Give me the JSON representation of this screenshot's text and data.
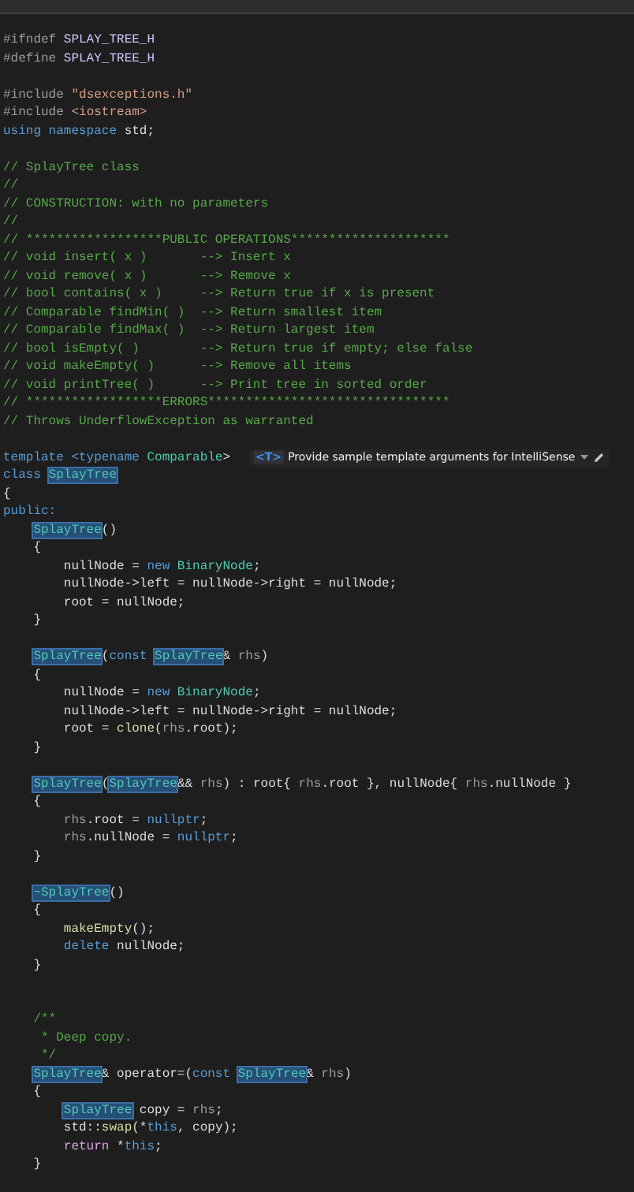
{
  "editor": {
    "lines": [
      {
        "kind": "code",
        "tokens": [
          {
            "text": "#ifndef ",
            "kind": "pre"
          },
          {
            "text": "SPLAY_TREE_H",
            "kind": "macro"
          }
        ]
      },
      {
        "kind": "code",
        "tokens": [
          {
            "text": "#define ",
            "kind": "pre"
          },
          {
            "text": "SPLAY_TREE_H",
            "kind": "macro"
          }
        ]
      },
      {
        "kind": "blank"
      },
      {
        "kind": "code",
        "tokens": [
          {
            "text": "#include ",
            "kind": "pre"
          },
          {
            "text": "\"dsexceptions.h\"",
            "kind": "str"
          }
        ]
      },
      {
        "kind": "code",
        "tokens": [
          {
            "text": "#include ",
            "kind": "pre"
          },
          {
            "text": "<iostream>",
            "kind": "str"
          }
        ]
      },
      {
        "kind": "code",
        "tokens": [
          {
            "text": "using namespace ",
            "kind": "kw"
          },
          {
            "text": "std;",
            "kind": "plain"
          }
        ]
      },
      {
        "kind": "blank"
      },
      {
        "kind": "code",
        "tokens": [
          {
            "text": "// SplayTree class",
            "kind": "cm"
          }
        ]
      },
      {
        "kind": "code",
        "tokens": [
          {
            "text": "//",
            "kind": "cm"
          }
        ]
      },
      {
        "kind": "code",
        "tokens": [
          {
            "text": "// CONSTRUCTION: with no parameters",
            "kind": "cm"
          }
        ]
      },
      {
        "kind": "code",
        "tokens": [
          {
            "text": "//",
            "kind": "cm"
          }
        ]
      },
      {
        "kind": "code",
        "tokens": [
          {
            "text": "// ******************PUBLIC OPERATIONS*********************",
            "kind": "cm"
          }
        ]
      },
      {
        "kind": "code",
        "tokens": [
          {
            "text": "// void insert( x )       --> Insert x",
            "kind": "cm"
          }
        ]
      },
      {
        "kind": "code",
        "tokens": [
          {
            "text": "// void remove( x )       --> Remove x",
            "kind": "cm"
          }
        ]
      },
      {
        "kind": "code",
        "tokens": [
          {
            "text": "// bool contains( x )     --> Return true if x is present",
            "kind": "cm"
          }
        ]
      },
      {
        "kind": "code",
        "tokens": [
          {
            "text": "// Comparable findMin( )  --> Return smallest item",
            "kind": "cm"
          }
        ]
      },
      {
        "kind": "code",
        "tokens": [
          {
            "text": "// Comparable findMax( )  --> Return largest item",
            "kind": "cm"
          }
        ]
      },
      {
        "kind": "code",
        "tokens": [
          {
            "text": "// bool isEmpty( )        --> Return true if empty; else false",
            "kind": "cm"
          }
        ]
      },
      {
        "kind": "code",
        "tokens": [
          {
            "text": "// void makeEmpty( )      --> Remove all items",
            "kind": "cm"
          }
        ]
      },
      {
        "kind": "code",
        "tokens": [
          {
            "text": "// void printTree( )      --> Print tree in sorted order",
            "kind": "cm"
          }
        ]
      },
      {
        "kind": "code",
        "tokens": [
          {
            "text": "// ******************ERRORS********************************",
            "kind": "cm"
          }
        ]
      },
      {
        "kind": "code",
        "tokens": [
          {
            "text": "// Throws UnderflowException as warranted",
            "kind": "cm"
          }
        ]
      },
      {
        "kind": "blank"
      },
      {
        "kind": "code",
        "tokens": [
          {
            "text": "template <typename ",
            "kind": "kw"
          },
          {
            "text": "Comparable",
            "kind": "type"
          },
          {
            "text": ">",
            "kind": "plain"
          }
        ],
        "hint": {
          "badge": "<T>",
          "text": "Provide sample template arguments for IntelliSense"
        }
      },
      {
        "kind": "code",
        "tokens": [
          {
            "text": "class ",
            "kind": "kw"
          },
          {
            "text": "SplayTree",
            "kind": "hl"
          }
        ]
      },
      {
        "kind": "code",
        "tokens": [
          {
            "text": "{",
            "kind": "plain"
          }
        ]
      },
      {
        "kind": "code",
        "tokens": [
          {
            "text": "public:",
            "kind": "kw"
          }
        ]
      },
      {
        "kind": "code",
        "tokens": [
          {
            "text": "    SplayTree",
            "kind": "hl"
          },
          {
            "text": "()",
            "kind": "plain"
          }
        ]
      },
      {
        "kind": "code",
        "tokens": [
          {
            "text": "    {",
            "kind": "plain"
          }
        ]
      },
      {
        "kind": "code",
        "tokens": [
          {
            "text": "        nullNode = ",
            "kind": "plain"
          },
          {
            "text": "new ",
            "kind": "kw"
          },
          {
            "text": "BinaryNode",
            "kind": "type"
          },
          {
            "text": ";",
            "kind": "plain"
          }
        ]
      },
      {
        "kind": "code",
        "tokens": [
          {
            "text": "        nullNode->left = nullNode->right = nullNode;",
            "kind": "plain"
          }
        ]
      },
      {
        "kind": "code",
        "tokens": [
          {
            "text": "        root = nullNode;",
            "kind": "plain"
          }
        ]
      },
      {
        "kind": "code",
        "tokens": [
          {
            "text": "    }",
            "kind": "plain"
          }
        ]
      },
      {
        "kind": "blank"
      },
      {
        "kind": "code",
        "tokens": [
          {
            "text": "    SplayTree",
            "kind": "hl"
          },
          {
            "text": "(",
            "kind": "plain"
          },
          {
            "text": "const ",
            "kind": "kw"
          },
          {
            "text": "SplayTree",
            "kind": "hl"
          },
          {
            "text": "& ",
            "kind": "plain"
          },
          {
            "text": "rhs",
            "kind": "param"
          },
          {
            "text": ")",
            "kind": "plain"
          }
        ]
      },
      {
        "kind": "code",
        "tokens": [
          {
            "text": "    {",
            "kind": "plain"
          }
        ]
      },
      {
        "kind": "code",
        "tokens": [
          {
            "text": "        nullNode = ",
            "kind": "plain"
          },
          {
            "text": "new ",
            "kind": "kw"
          },
          {
            "text": "BinaryNode",
            "kind": "type"
          },
          {
            "text": ";",
            "kind": "plain"
          }
        ]
      },
      {
        "kind": "code",
        "tokens": [
          {
            "text": "        nullNode->left = nullNode->right = nullNode;",
            "kind": "plain"
          }
        ]
      },
      {
        "kind": "code",
        "tokens": [
          {
            "text": "        root = ",
            "kind": "plain"
          },
          {
            "text": "clone",
            "kind": "fn"
          },
          {
            "text": "(",
            "kind": "plain"
          },
          {
            "text": "rhs",
            "kind": "param"
          },
          {
            "text": ".root);",
            "kind": "plain"
          }
        ]
      },
      {
        "kind": "code",
        "tokens": [
          {
            "text": "    }",
            "kind": "plain"
          }
        ]
      },
      {
        "kind": "blank"
      },
      {
        "kind": "code",
        "tokens": [
          {
            "text": "    SplayTree",
            "kind": "hl"
          },
          {
            "text": "(",
            "kind": "plain"
          },
          {
            "text": "SplayTree",
            "kind": "hl"
          },
          {
            "text": "&& ",
            "kind": "plain"
          },
          {
            "text": "rhs",
            "kind": "param"
          },
          {
            "text": ") : root{ ",
            "kind": "plain"
          },
          {
            "text": "rhs",
            "kind": "param"
          },
          {
            "text": ".root }, nullNode{ ",
            "kind": "plain"
          },
          {
            "text": "rhs",
            "kind": "param"
          },
          {
            "text": ".nullNode }",
            "kind": "plain"
          }
        ]
      },
      {
        "kind": "code",
        "tokens": [
          {
            "text": "    {",
            "kind": "plain"
          }
        ]
      },
      {
        "kind": "code",
        "tokens": [
          {
            "text": "        rhs",
            "kind": "param"
          },
          {
            "text": ".root = ",
            "kind": "plain"
          },
          {
            "text": "nullptr",
            "kind": "kw"
          },
          {
            "text": ";",
            "kind": "plain"
          }
        ]
      },
      {
        "kind": "code",
        "tokens": [
          {
            "text": "        rhs",
            "kind": "param"
          },
          {
            "text": ".nullNode = ",
            "kind": "plain"
          },
          {
            "text": "nullptr",
            "kind": "kw"
          },
          {
            "text": ";",
            "kind": "plain"
          }
        ]
      },
      {
        "kind": "code",
        "tokens": [
          {
            "text": "    }",
            "kind": "plain"
          }
        ]
      },
      {
        "kind": "blank"
      },
      {
        "kind": "code",
        "tokens": [
          {
            "text": "    ~SplayTree",
            "kind": "hl"
          },
          {
            "text": "()",
            "kind": "plain"
          }
        ]
      },
      {
        "kind": "code",
        "tokens": [
          {
            "text": "    {",
            "kind": "plain"
          }
        ]
      },
      {
        "kind": "code",
        "tokens": [
          {
            "text": "        makeEmpty",
            "kind": "fn"
          },
          {
            "text": "();",
            "kind": "plain"
          }
        ]
      },
      {
        "kind": "code",
        "tokens": [
          {
            "text": "        delete ",
            "kind": "kw"
          },
          {
            "text": "nullNode;",
            "kind": "plain"
          }
        ]
      },
      {
        "kind": "code",
        "tokens": [
          {
            "text": "    }",
            "kind": "plain"
          }
        ]
      },
      {
        "kind": "blank"
      },
      {
        "kind": "blank"
      },
      {
        "kind": "code",
        "tokens": [
          {
            "text": "    /**",
            "kind": "cm"
          }
        ]
      },
      {
        "kind": "code",
        "tokens": [
          {
            "text": "     * Deep copy.",
            "kind": "cm"
          }
        ]
      },
      {
        "kind": "code",
        "tokens": [
          {
            "text": "     */",
            "kind": "cm"
          }
        ]
      },
      {
        "kind": "code",
        "tokens": [
          {
            "text": "    SplayTree",
            "kind": "hl"
          },
          {
            "text": "& operator=(",
            "kind": "plain"
          },
          {
            "text": "const ",
            "kind": "kw"
          },
          {
            "text": "SplayTree",
            "kind": "hl"
          },
          {
            "text": "& ",
            "kind": "plain"
          },
          {
            "text": "rhs",
            "kind": "param"
          },
          {
            "text": ")",
            "kind": "plain"
          }
        ]
      },
      {
        "kind": "code",
        "tokens": [
          {
            "text": "    {",
            "kind": "plain"
          }
        ]
      },
      {
        "kind": "code",
        "tokens": [
          {
            "text": "        SplayTree",
            "kind": "hl"
          },
          {
            "text": " copy = ",
            "kind": "plain"
          },
          {
            "text": "rhs",
            "kind": "param"
          },
          {
            "text": ";",
            "kind": "plain"
          }
        ]
      },
      {
        "kind": "code",
        "tokens": [
          {
            "text": "        std::",
            "kind": "plain"
          },
          {
            "text": "swap",
            "kind": "fn"
          },
          {
            "text": "(*",
            "kind": "plain"
          },
          {
            "text": "this",
            "kind": "kw"
          },
          {
            "text": ", copy);",
            "kind": "plain"
          }
        ]
      },
      {
        "kind": "code",
        "tokens": [
          {
            "text": "        return ",
            "kind": "ctl"
          },
          {
            "text": "*",
            "kind": "plain"
          },
          {
            "text": "this",
            "kind": "kw"
          },
          {
            "text": ";",
            "kind": "plain"
          }
        ]
      },
      {
        "kind": "code",
        "tokens": [
          {
            "text": "    }",
            "kind": "plain"
          }
        ]
      }
    ]
  }
}
